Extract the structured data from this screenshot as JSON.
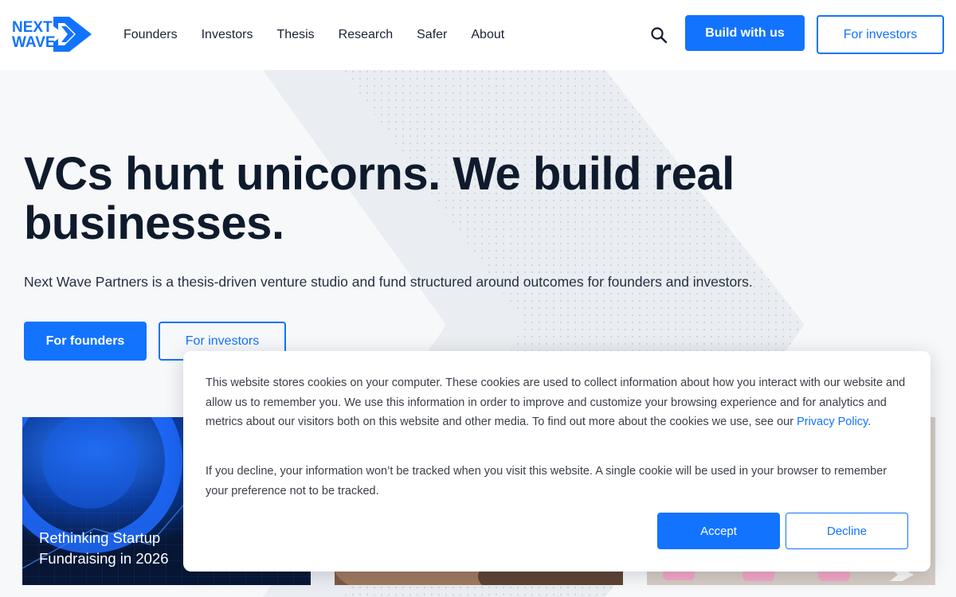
{
  "header": {
    "logo_text_top": "NEXT",
    "logo_text_bottom": "WAVE",
    "nav": [
      "Founders",
      "Investors",
      "Thesis",
      "Research",
      "Safer",
      "About"
    ],
    "search_icon": "search-icon",
    "build_label": "Build with us",
    "investors_label": "For investors"
  },
  "hero": {
    "title": "VCs hunt unicorns. We build real businesses.",
    "subtitle": "Next Wave Partners is a thesis-driven venture studio and fund structured around outcomes for founders and investors.",
    "founders_label": "For founders",
    "investors_label": "For investors"
  },
  "cards": [
    {
      "title": "Rethinking Startup Fundraising in 2026"
    },
    {
      "title": ""
    },
    {
      "title": ""
    }
  ],
  "cookie": {
    "text_1": "This website stores cookies on your computer. These cookies are used to collect information about how you interact with our website and allow us to remember you. We use this information in order to improve and customize your browsing experience and for analytics and metrics about our visitors both on this website and other media. To find out more about the cookies we use, see our ",
    "privacy_link": "Privacy Policy",
    "text_1_end": ".",
    "text_2": "If you decline, your information won’t be tracked when you visit this website. A single cookie will be used in your browser to remember your preference not to be tracked.",
    "accept_label": "Accept",
    "decline_label": "Decline"
  },
  "colors": {
    "accent": "#1273ff",
    "text_dark": "#0f1b2d",
    "background": "#f7f8fa"
  }
}
